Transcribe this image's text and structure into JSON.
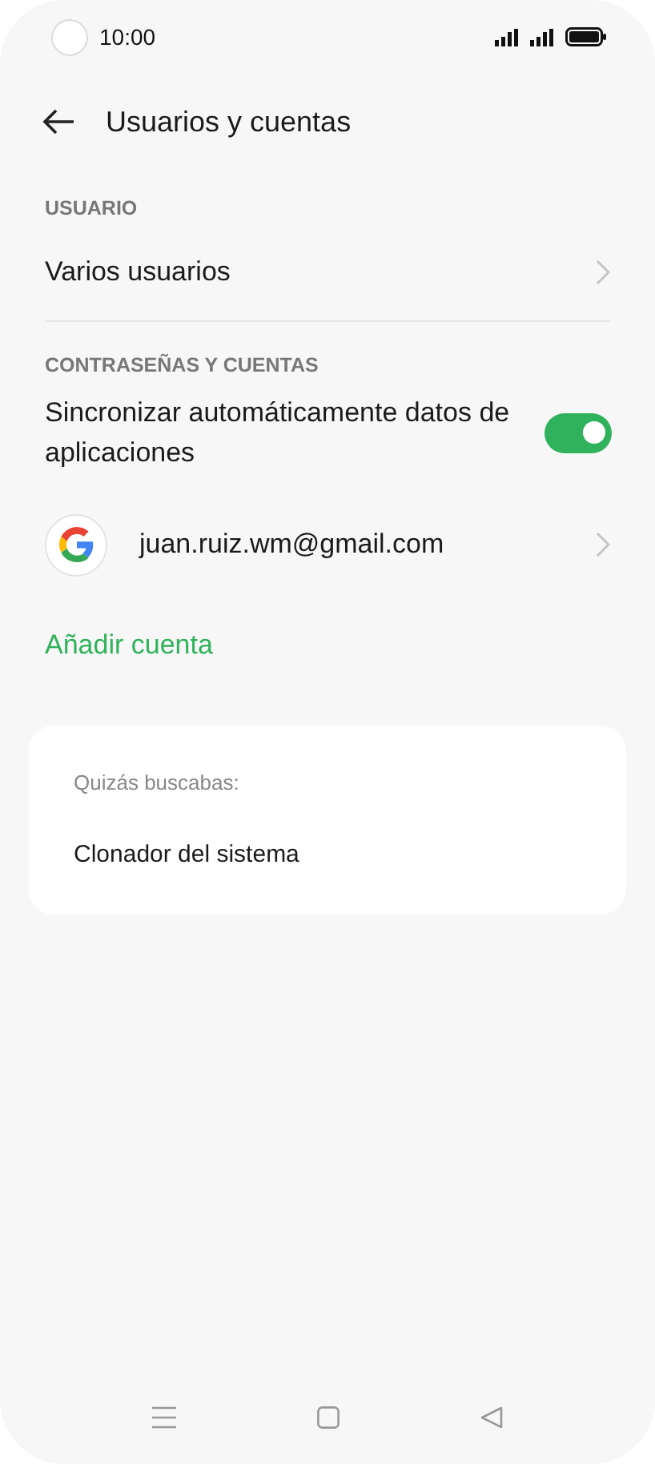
{
  "status_bar": {
    "time": "10:00"
  },
  "header": {
    "title": "Usuarios y cuentas"
  },
  "sections": [
    {
      "heading": "USUARIO",
      "items": [
        {
          "kind": "link",
          "label": "Varios usuarios"
        }
      ]
    },
    {
      "heading": "CONTRASEÑAS Y CUENTAS",
      "items": [
        {
          "kind": "toggle",
          "label": "Sincronizar automáticamente datos de aplicaciones",
          "on": true
        },
        {
          "kind": "account",
          "label": "juan.ruiz.wm@gmail.com"
        },
        {
          "kind": "action",
          "label": "Añadir cuenta"
        }
      ]
    }
  ],
  "suggestions": {
    "heading": "Quizás buscabas:",
    "items": [
      "Clonador del sistema"
    ]
  }
}
